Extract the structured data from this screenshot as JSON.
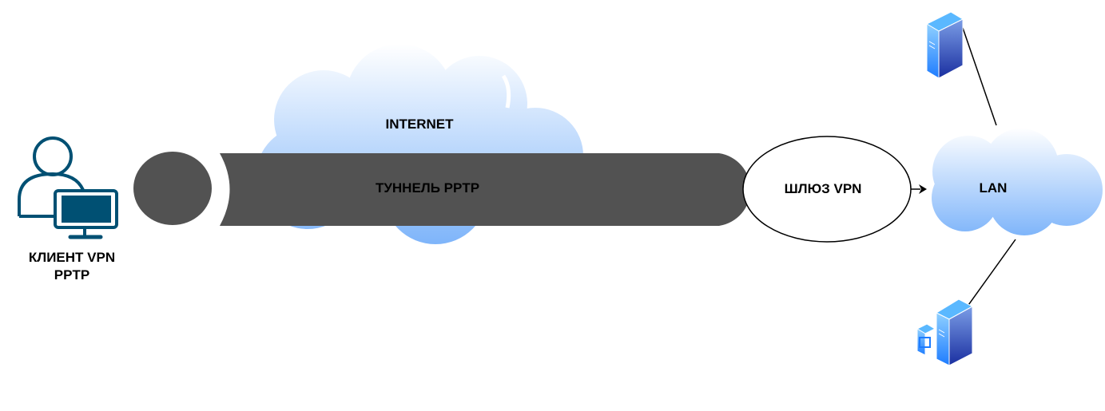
{
  "nodes": {
    "client": {
      "line1": "КЛИЕНТ VPN",
      "line2": "PPTP",
      "icon": "user-with-monitor-icon",
      "color": "#005073"
    },
    "internet": {
      "label": "INTERNET",
      "icon": "cloud-icon"
    },
    "tunnel": {
      "label": "ТУННЕЛЬ PPTP",
      "color": "#525252"
    },
    "gateway": {
      "label": "ШЛЮЗ VPN"
    },
    "lan": {
      "label": "LAN",
      "icon": "cloud-icon"
    },
    "servers": [
      {
        "icon": "server-tower-icon"
      },
      {
        "icon": "server-with-workstation-icon"
      }
    ]
  },
  "colors": {
    "cloud_top": "#ffffff",
    "cloud_bottom": "#7fb5fa",
    "server_light": "#5ab0ff",
    "server_dark": "#1a3fa8"
  }
}
